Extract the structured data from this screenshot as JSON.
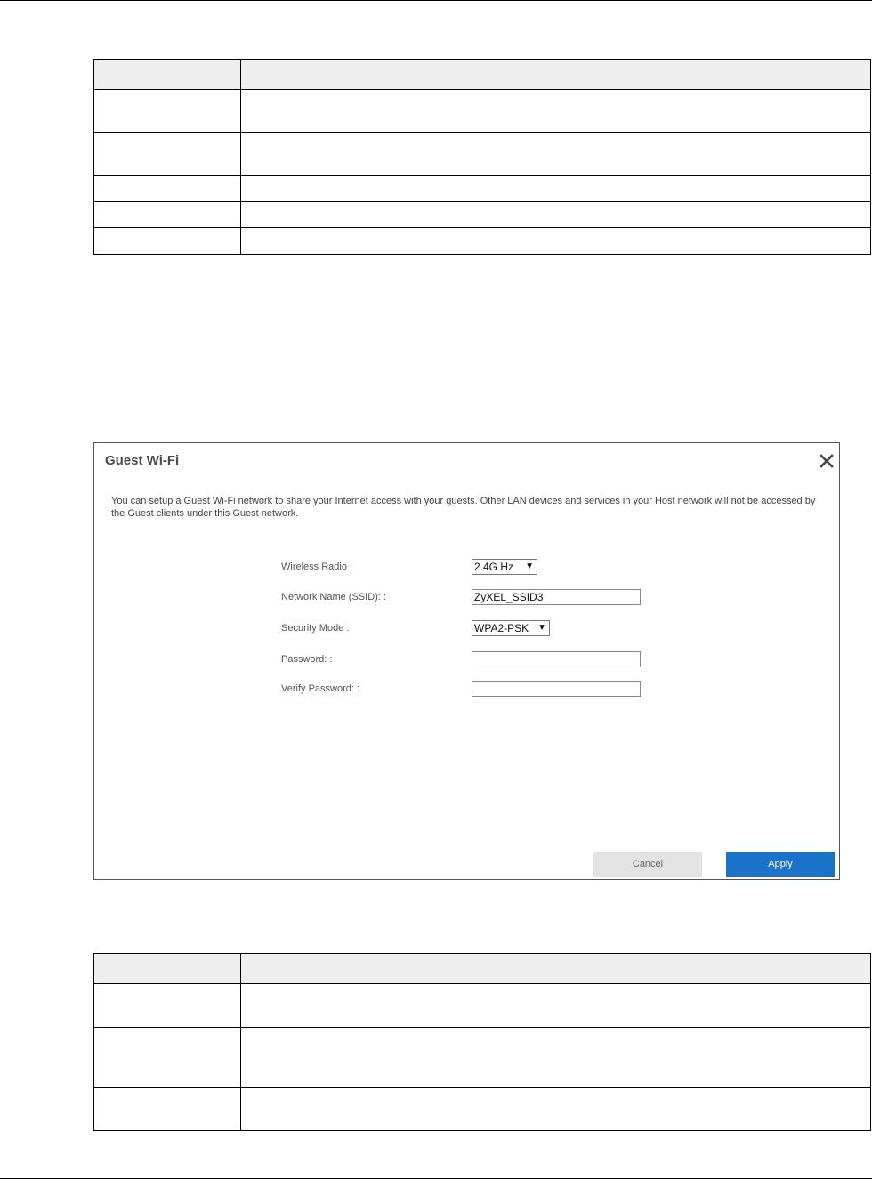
{
  "dialog": {
    "title": "Guest Wi-Fi",
    "description": "You can setup a Guest Wi-Fi network to share your Internet access with your guests. Other LAN devices and services in your Host network will not be accessed by the Guest clients under this Guest network.",
    "fields": {
      "wireless_radio": {
        "label": "Wireless Radio :",
        "value": "2.4G Hz"
      },
      "network_name": {
        "label": "Network Name (SSID): :",
        "value": "ZyXEL_SSID3"
      },
      "security_mode": {
        "label": "Security Mode :",
        "value": "WPA2-PSK"
      },
      "password": {
        "label": "Password: :",
        "value": ""
      },
      "verify_password": {
        "label": "Verify Password: :",
        "value": ""
      }
    },
    "buttons": {
      "cancel": "Cancel",
      "apply": "Apply"
    },
    "colors": {
      "apply_bg": "#1a73c9",
      "cancel_bg": "#e3e3e3"
    },
    "icons": {
      "close": "close-icon",
      "dropdown": "dropdown-arrow-icon"
    }
  }
}
